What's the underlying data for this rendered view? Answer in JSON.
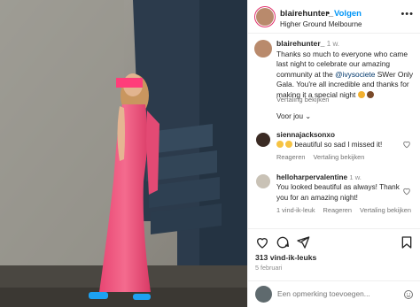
{
  "post": {
    "username": "blairehunter_",
    "follow_label": "Volgen",
    "location": "Higher Ground Melbourne",
    "more_label": "•••"
  },
  "caption": {
    "username": "blairehunter_",
    "time": "1 w.",
    "text_before": "Thanks so much to everyone who came last night to celebrate our amazing community at the ",
    "mention": "@ivysociete",
    "text_after": " SWer Only Gala. You're all incredible and thanks for making it a special night",
    "translate_label": "Vertaling bekijken"
  },
  "for_you_label": "Voor jou ⌄",
  "comments": [
    {
      "username": "siennajacksonxo",
      "text": "beautiful so sad I missed it!",
      "meta": [
        "Reageren",
        "Vertaling bekijken"
      ]
    },
    {
      "username": "helloharpervalentine",
      "time": "1 w.",
      "text": "You looked beautiful as always! Thank you for an amazing night!",
      "meta": [
        "1 vind-ik-leuk",
        "Reageren",
        "Vertaling bekijken"
      ]
    }
  ],
  "likes_label": "313 vind-ik-leuks",
  "date_label": "5 februari",
  "comment_placeholder": "Een opmerking toevoegen...",
  "colors": {
    "follow": "#0095f6",
    "muted": "#737373",
    "mention": "#00376b",
    "dress": "#f0547e"
  }
}
